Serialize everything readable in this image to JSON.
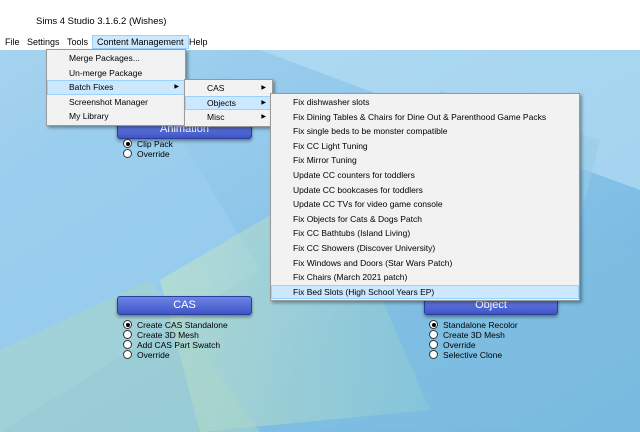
{
  "app": {
    "title": "Sims 4 Studio 3.1.6.2 (Wishes)"
  },
  "menubar": [
    "File",
    "Settings",
    "Tools",
    "Content Management",
    "Help"
  ],
  "content_menu": [
    "Merge Packages...",
    "Un-merge Package",
    "Batch Fixes",
    "Screenshot Manager",
    "My Library"
  ],
  "batch_menu": [
    "CAS",
    "Objects",
    "Misc"
  ],
  "objects_menu": [
    "Fix dishwasher slots",
    "Fix Dining Tables & Chairs for Dine Out & Parenthood Game Packs",
    "Fix single beds to be monster compatible",
    "Fix CC Light Tuning",
    "Fix Mirror Tuning",
    "Update CC counters for toddlers",
    "Update CC bookcases for toddlers",
    "Update CC TVs for video game console",
    "Fix Objects for Cats & Dogs Patch",
    "Fix CC Bathtubs (Island Living)",
    "Fix CC Showers (Discover University)",
    "Fix Windows and Doors (Star Wars Patch)",
    "Fix Chairs (March 2021 patch)",
    "Fix Bed Slots (High School Years EP)"
  ],
  "animation": {
    "label": "Animation",
    "options": [
      "Clip Pack",
      "Override"
    ]
  },
  "cas": {
    "label": "CAS",
    "options": [
      "Create CAS Standalone",
      "Create 3D Mesh",
      "Add CAS Part Swatch",
      "Override"
    ]
  },
  "object": {
    "label": "Object",
    "options": [
      "Standalone Recolor",
      "Create 3D Mesh",
      "Override",
      "Selective Clone"
    ]
  }
}
